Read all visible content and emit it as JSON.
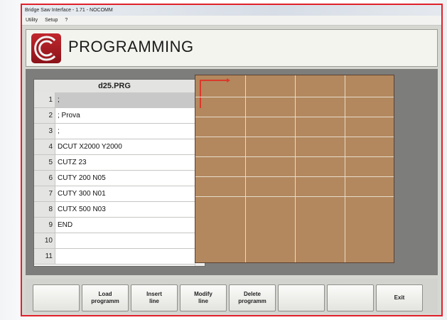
{
  "window": {
    "title": "Bridge Saw Interface - 1.71 - NOCOMM"
  },
  "menu": {
    "items": [
      "Utility",
      "Setup",
      "?"
    ]
  },
  "header": {
    "title": "PROGRAMMING"
  },
  "editor": {
    "filename": "d25.PRG",
    "lines": [
      {
        "num": "1",
        "code": ";",
        "selected": true
      },
      {
        "num": "2",
        "code": "; Prova"
      },
      {
        "num": "3",
        "code": ";"
      },
      {
        "num": "4",
        "code": "DCUT X2000 Y2000"
      },
      {
        "num": "5",
        "code": "CUTZ 23"
      },
      {
        "num": "6",
        "code": "CUTY 200 N05"
      },
      {
        "num": "7",
        "code": "CUTY 300 N01"
      },
      {
        "num": "8",
        "code": "CUTX 500 N03"
      },
      {
        "num": "9",
        "code": "END"
      },
      {
        "num": "10",
        "code": ""
      },
      {
        "num": "11",
        "code": ""
      }
    ]
  },
  "canvas": {
    "color": "#b3885e",
    "grid_color": "#e6dccb",
    "origin_color": "#d83a2a"
  },
  "buttons": [
    {
      "name": "blank-button-1",
      "label": ""
    },
    {
      "name": "load-programm-button",
      "label": "Load\nprogramm"
    },
    {
      "name": "insert-line-button",
      "label": "Insert\nline"
    },
    {
      "name": "modify-line-button",
      "label": "Modify\nline"
    },
    {
      "name": "delete-programm-button",
      "label": "Delete\nprogramm"
    },
    {
      "name": "blank-button-2",
      "label": ""
    },
    {
      "name": "blank-button-3",
      "label": ""
    },
    {
      "name": "exit-button",
      "label": "Exit"
    }
  ]
}
